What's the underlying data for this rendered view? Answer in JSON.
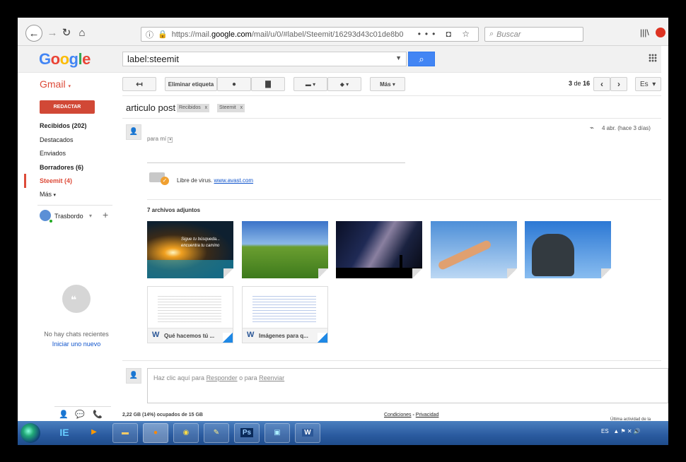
{
  "browser": {
    "url_prefix": "https://mail.",
    "url_domain": "google.com",
    "url_suffix": "/mail/u/0/#label/Steemit/16293d43c01de8b0",
    "url_tools": "•••",
    "search_placeholder": "Buscar"
  },
  "gmail": {
    "logo_letters": [
      "G",
      "o",
      "o",
      "g",
      "l",
      "e"
    ],
    "search_query": "label:steemit",
    "app_label": "Gmail",
    "toolbar": {
      "remove_label": "Eliminar etiqueta",
      "more_label": "Más",
      "count_current": "3",
      "count_sep": "de",
      "count_total": "16",
      "lang": "Es"
    },
    "compose": "REDACTAR",
    "nav": [
      {
        "label": "Recibidos (202)"
      },
      {
        "label": "Destacados"
      },
      {
        "label": "Enviados"
      },
      {
        "label": "Borradores (6)"
      },
      {
        "label": "Steemit (4)"
      },
      {
        "label": "Más"
      }
    ],
    "chat": {
      "user": "Trasbordo",
      "no_chats": "No hay chats recientes",
      "new_chat": "Iniciar uno nuevo"
    },
    "thread": {
      "subject": "articulo post",
      "tags": [
        "Recibidos",
        "Steemit"
      ],
      "tag_close": "x",
      "to": "para mí",
      "date": "4 abr. (hace 3 días)",
      "virus_text": "Libre de virus.",
      "virus_link": "www.avast.com",
      "attachments_title": "7 archivos adjuntos",
      "image_caption": "Sigue tu búsqueda... encuentra tu camino",
      "docs": [
        "Qué hacemos tú ...",
        "Imágenes para q..."
      ],
      "reply_prefix": "Haz clic aquí para",
      "reply_link": "Responder",
      "reply_mid": "o para",
      "forward_link": "Reenviar"
    },
    "footer": {
      "storage": "2,22 GB (14%) ocupados de 15 GB",
      "terms": "Condiciones",
      "terms_sep": "-",
      "privacy": "Privacidad",
      "last_activity": "Última actividad de la"
    }
  },
  "taskbar": {
    "apps": [
      "IE",
      "WMP",
      "Explorer",
      "Firefox",
      "Chrome",
      "Paint",
      "Ps",
      "Photos",
      "Word"
    ],
    "lang": "ES"
  }
}
